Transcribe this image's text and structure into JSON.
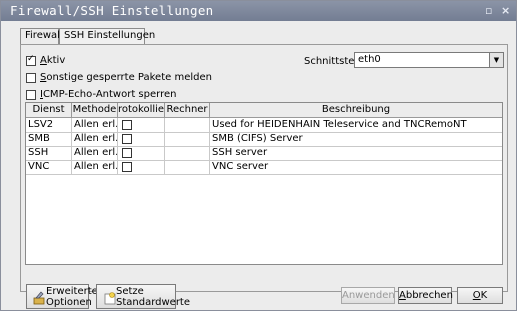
{
  "window": {
    "title": "Firewall/SSH Einstellungen",
    "buttons": {
      "restore": "▫",
      "close": "×"
    }
  },
  "tabs": [
    {
      "label": "Firewall",
      "active": true
    },
    {
      "label": "SSH Einstellungen",
      "active": false
    }
  ],
  "options": {
    "aktiv": {
      "accel": "A",
      "rest": "ktiv",
      "checked": true
    },
    "sonstige": {
      "accel": "S",
      "rest": "onstige gesperrte Pakete melden",
      "checked": false
    },
    "icmp": {
      "accel": "I",
      "rest": "CMP-Echo-Antwort sperren",
      "checked": false
    }
  },
  "interface": {
    "label": "Schnittstelle",
    "value": "eth0"
  },
  "table": {
    "headers": [
      "Dienst",
      "Methode",
      "rotokolliere",
      "Rechner",
      "Beschreibung"
    ],
    "rows": [
      {
        "dienst": "LSV2",
        "methode": "Allen erl...",
        "rechner": "",
        "beschreibung": "Used for HEIDENHAIN Teleservice and TNCRemoNT"
      },
      {
        "dienst": "SMB",
        "methode": "Allen erl...",
        "rechner": "",
        "beschreibung": "SMB (CIFS) Server"
      },
      {
        "dienst": "SSH",
        "methode": "Allen erl...",
        "rechner": "",
        "beschreibung": "SSH server"
      },
      {
        "dienst": "VNC",
        "methode": "Allen erl...",
        "rechner": "",
        "beschreibung": "VNC server"
      }
    ]
  },
  "footer": {
    "erweiterte": [
      "Erweiterte",
      "Optionen"
    ],
    "setze": [
      "Setze",
      "Standardwerte"
    ],
    "anwenden": "Anwenden",
    "abbrechen": {
      "accel": "A",
      "rest": "bbrechen"
    },
    "ok": {
      "accel": "O",
      "rest": "K"
    }
  }
}
